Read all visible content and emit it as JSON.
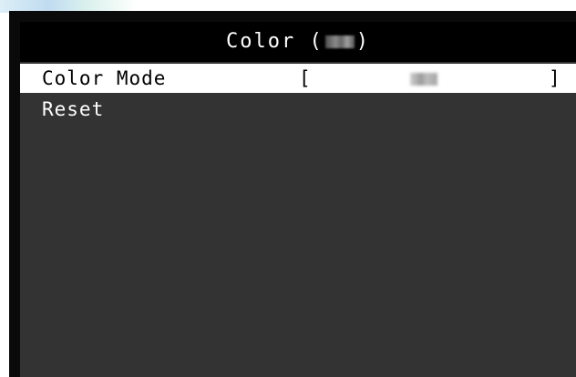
{
  "osd": {
    "title_prefix": "Color (",
    "title_suffix": ")",
    "items": [
      {
        "label": "Color Mode",
        "bracket_open": "[",
        "bracket_close": "]",
        "selected": true
      },
      {
        "label": "Reset",
        "selected": false
      }
    ]
  },
  "colors": {
    "background": "#333333",
    "title_bar": "#000000",
    "selected_row": "#ffffff",
    "text": "#ffffff"
  }
}
